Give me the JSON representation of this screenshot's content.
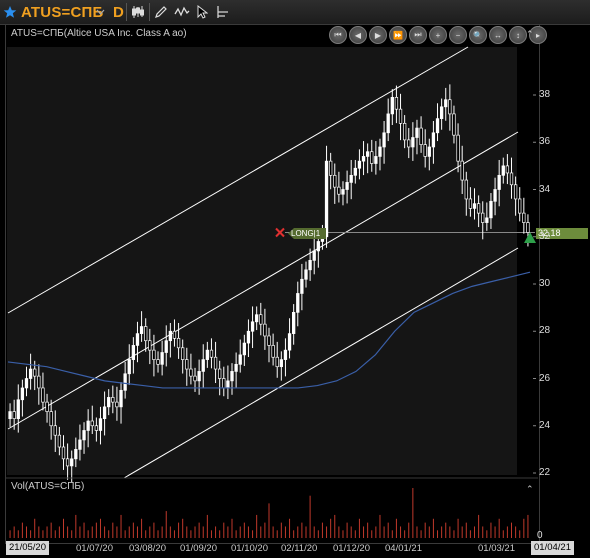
{
  "toolbar": {
    "ticker": "ATUS=СПБ",
    "period": "D",
    "icons": [
      "star-icon",
      "dropdown-chevron-icon",
      "candlestick-icon",
      "pencil-icon",
      "wave-icon",
      "pointer-icon",
      "crosshair-icon"
    ]
  },
  "chart": {
    "title": "ATUS=СПБ(Altice USA Inc. Class A ao)",
    "volume_title": "Vol(ATUS=СПБ)",
    "position_label": "LONG|1",
    "last_price": "32,18",
    "nav_icons": [
      "first-icon",
      "prev-icon",
      "play-icon",
      "next-icon",
      "last-icon",
      "zoom-in-icon",
      "zoom-out-icon",
      "magnifier-icon",
      "pan-horizontal-icon",
      "pan-vertical-icon",
      "scroll-right-icon"
    ],
    "colors": {
      "up": "#ffffff",
      "channel": "#ffffff",
      "ma": "#3a5fa8",
      "volume": "#c0392b",
      "price_tag": "#6d8c3c",
      "triangle": "#2ea04a",
      "marker": "#e03030"
    }
  },
  "chart_data": {
    "type": "candlestick",
    "y_ticks": [
      "38",
      "36",
      "34",
      "32",
      "30",
      "28",
      "26",
      "24",
      "22"
    ],
    "volume_ticks": [
      "0"
    ],
    "x_labels": [
      "21/05/20",
      "01/07/20",
      "03/08/20",
      "01/09/20",
      "01/10/20",
      "02/11/20",
      "01/12/20",
      "04/01/21",
      "01/03/21",
      "01/04/21"
    ],
    "ylim": [
      21.5,
      39.5
    ],
    "last_price": 32.18,
    "closes": [
      24.6,
      24.3,
      25.1,
      25.6,
      26.0,
      26.4,
      26.1,
      25.6,
      25.0,
      24.6,
      24.0,
      23.6,
      23.1,
      22.6,
      22.3,
      22.6,
      23.0,
      23.4,
      23.8,
      24.2,
      24.0,
      23.8,
      24.3,
      24.8,
      25.2,
      25.0,
      24.8,
      25.5,
      26.2,
      26.8,
      27.4,
      27.9,
      28.2,
      27.6,
      27.2,
      26.8,
      26.6,
      27.1,
      27.6,
      28.0,
      27.7,
      27.3,
      26.8,
      26.4,
      26.1,
      25.9,
      26.3,
      26.8,
      27.2,
      26.9,
      26.4,
      26.0,
      25.6,
      25.9,
      26.3,
      26.6,
      27.0,
      27.5,
      28.0,
      28.4,
      28.7,
      28.3,
      27.8,
      27.4,
      26.9,
      26.5,
      26.8,
      27.2,
      27.9,
      28.8,
      29.6,
      30.2,
      30.6,
      31.0,
      31.4,
      31.8,
      32.0,
      35.2,
      34.6,
      34.1,
      33.8,
      34.0,
      34.3,
      34.6,
      34.9,
      35.2,
      35.4,
      35.6,
      35.1,
      35.4,
      35.8,
      36.4,
      37.2,
      37.9,
      37.4,
      36.8,
      36.1,
      35.8,
      36.2,
      36.6,
      35.9,
      35.4,
      35.8,
      36.4,
      37.0,
      37.5,
      37.8,
      37.2,
      36.3,
      35.2,
      34.4,
      33.6,
      33.2,
      33.4,
      33.0,
      32.6,
      32.8,
      33.5,
      34.0,
      34.6,
      35.0,
      34.7,
      34.2,
      33.6,
      33.0,
      32.6,
      32.18
    ],
    "volume": [
      2,
      3,
      2,
      4,
      3,
      2,
      5,
      3,
      2,
      3,
      4,
      2,
      3,
      5,
      3,
      2,
      6,
      3,
      4,
      2,
      3,
      4,
      5,
      3,
      2,
      4,
      3,
      6,
      2,
      3,
      4,
      3,
      5,
      2,
      3,
      4,
      2,
      3,
      7,
      3,
      2,
      4,
      5,
      3,
      2,
      3,
      4,
      3,
      6,
      2,
      3,
      2,
      4,
      3,
      5,
      2,
      3,
      4,
      3,
      2,
      6,
      3,
      4,
      9,
      3,
      2,
      4,
      3,
      5,
      2,
      3,
      4,
      3,
      11,
      3,
      2,
      4,
      3,
      5,
      6,
      3,
      2,
      4,
      3,
      2,
      5,
      3,
      4,
      2,
      3,
      6,
      3,
      4,
      2,
      5,
      3,
      2,
      4,
      13,
      3,
      2,
      4,
      3,
      5,
      2,
      3,
      4,
      3,
      2,
      5,
      3,
      4,
      2,
      3,
      6,
      3,
      2,
      4,
      3,
      5,
      2,
      3,
      4,
      3,
      2,
      5,
      6
    ],
    "ma": [
      26.7,
      26.6,
      26.5,
      26.3,
      26.1,
      25.9,
      25.8,
      25.7,
      25.6,
      25.6,
      25.6,
      25.6,
      25.6,
      25.6,
      25.6,
      25.6,
      25.7,
      25.9,
      26.3,
      27.0,
      28.0,
      28.8,
      29.2,
      29.6,
      29.9,
      30.1,
      30.3,
      30.5
    ]
  }
}
